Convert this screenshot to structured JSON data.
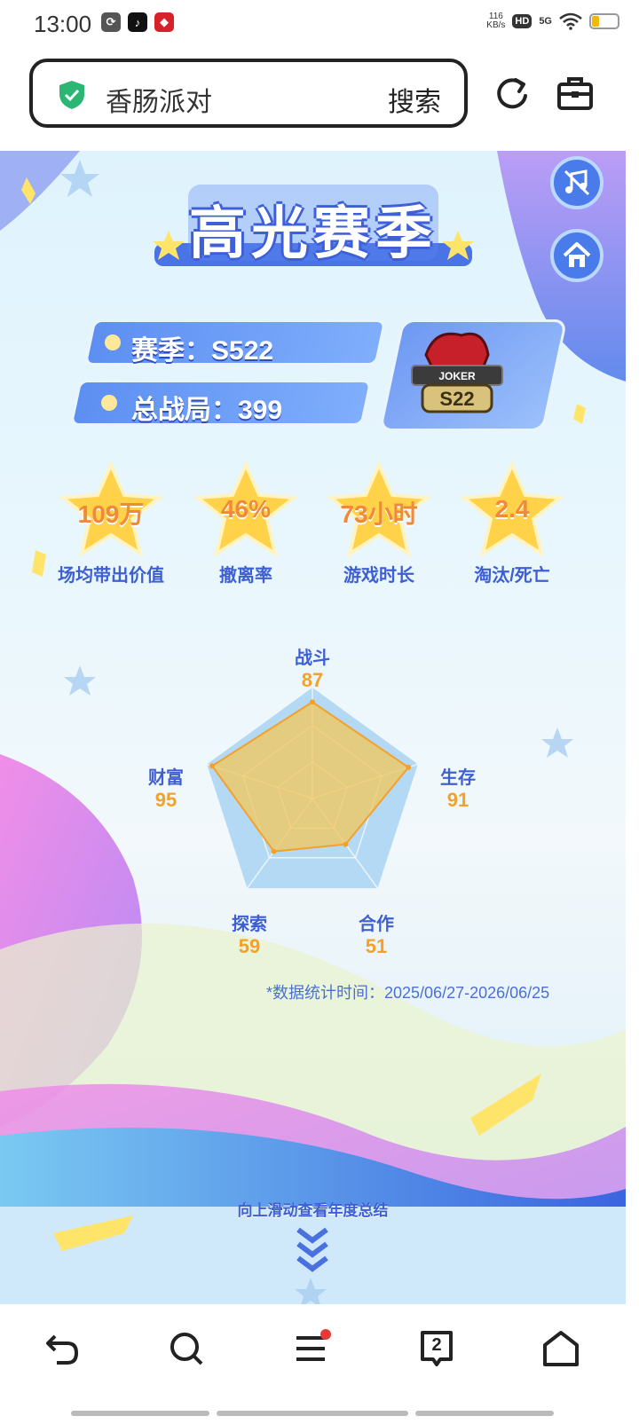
{
  "status_bar": {
    "time": "13:00",
    "speed_value": "116",
    "speed_unit": "KB/s",
    "hd_label": "HD",
    "network_label": "5G",
    "battery": "25",
    "battery_level": 0.25
  },
  "search": {
    "query": "香肠派对",
    "button_label": "搜索"
  },
  "game": {
    "title": "高光赛季",
    "season_label": "赛季：",
    "season_value": "S522",
    "total_label": "总战局：",
    "total_value": "399",
    "badge_text": "JOKER",
    "badge_season": "S22",
    "stats": [
      {
        "value": "109万",
        "label": "场均带出价值"
      },
      {
        "value": "46%",
        "label": "撤离率"
      },
      {
        "value": "73小时",
        "label": "游戏时长"
      },
      {
        "value": "2.4",
        "label": "淘汰/死亡"
      }
    ],
    "radar": [
      {
        "name": "战斗",
        "value": 87
      },
      {
        "name": "生存",
        "value": 91
      },
      {
        "name": "合作",
        "value": 51
      },
      {
        "name": "探索",
        "value": 59
      },
      {
        "name": "财富",
        "value": 95
      }
    ],
    "stat_period_note": "*数据统计时间：2025/06/27-2026/06/25",
    "swipe_tip": "向上滑动查看年度总结"
  },
  "nav": {
    "tabs_count": "2"
  },
  "colors": {
    "accent_blue": "#3e5fd4",
    "value_orange": "#f4a12a",
    "radar_fill": "#f3c55a",
    "radar_bg": "#a9d4f2",
    "shield_green": "#2bb673"
  }
}
